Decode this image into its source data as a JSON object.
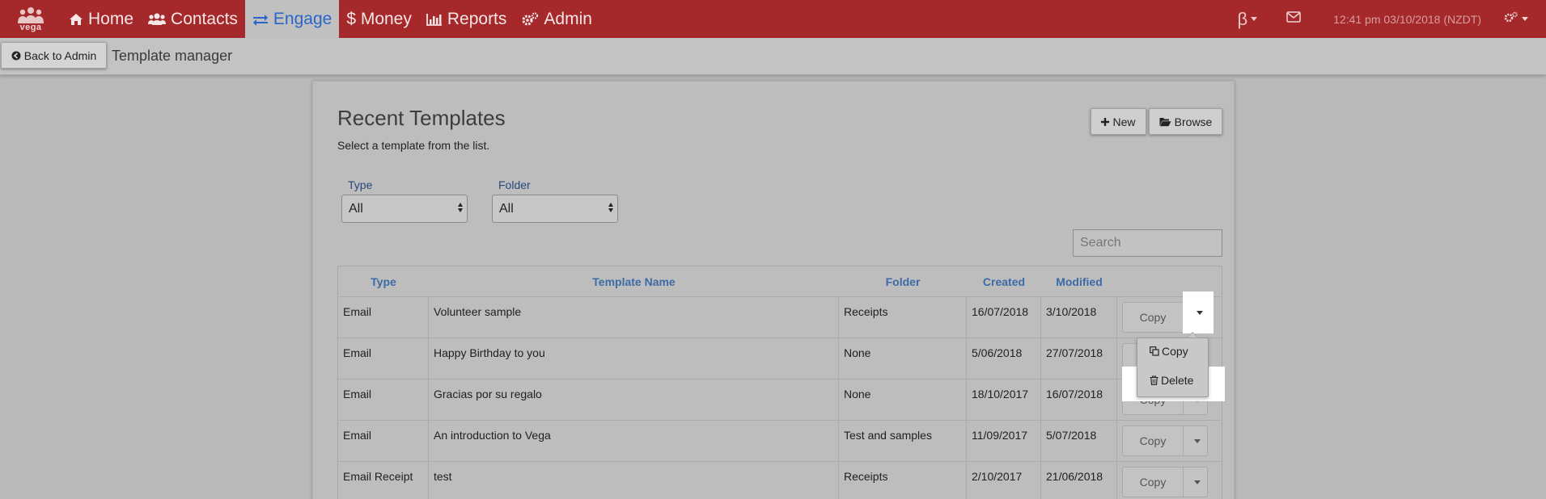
{
  "app": {
    "logo_text": "vega"
  },
  "nav": {
    "items": [
      {
        "label": "Home",
        "icon": "home-icon"
      },
      {
        "label": "Contacts",
        "icon": "users-icon"
      },
      {
        "label": "Engage",
        "icon": "exchange-icon",
        "active": true
      },
      {
        "label": "$ Money",
        "icon": ""
      },
      {
        "label": "Reports",
        "icon": "bar-chart-icon"
      },
      {
        "label": "Admin",
        "icon": "cogs-icon"
      }
    ],
    "beta": "β",
    "datetime": "12:41 pm 03/10/2018 (NZDT)"
  },
  "subbar": {
    "back_label": "Back to Admin",
    "title": "Template manager"
  },
  "main": {
    "heading": "Recent Templates",
    "subheading": "Select a template from the list.",
    "new_label": "New",
    "browse_label": "Browse",
    "filters": {
      "type_label": "Type",
      "type_value": "All",
      "folder_label": "Folder",
      "folder_value": "All"
    },
    "search_placeholder": "Search"
  },
  "table": {
    "headers": [
      "Type",
      "Template Name",
      "Folder",
      "Created",
      "Modified"
    ],
    "rows": [
      {
        "type": "Email",
        "name": "Volunteer sample",
        "folder": "Receipts",
        "created": "16/07/2018",
        "modified": "3/10/2018",
        "action": "Copy"
      },
      {
        "type": "Email",
        "name": "Happy Birthday to you",
        "folder": "None",
        "created": "5/06/2018",
        "modified": "27/07/2018",
        "action": ""
      },
      {
        "type": "Email",
        "name": "Gracias por su regalo",
        "folder": "None",
        "created": "18/10/2017",
        "modified": "16/07/2018",
        "action": "Copy"
      },
      {
        "type": "Email",
        "name": "An introduction to Vega",
        "folder": "Test and samples",
        "created": "11/09/2017",
        "modified": "5/07/2018",
        "action": "Copy"
      },
      {
        "type": "Email Receipt",
        "name": "test",
        "folder": "Receipts",
        "created": "2/10/2017",
        "modified": "21/06/2018",
        "action": "Copy"
      }
    ]
  },
  "dropdown_menu": {
    "copy_label": "Copy",
    "delete_label": "Delete"
  },
  "colors": {
    "navbar": "#a5282a",
    "active_tab_text": "#2a66c9",
    "header_text": "#3c6ba8"
  }
}
